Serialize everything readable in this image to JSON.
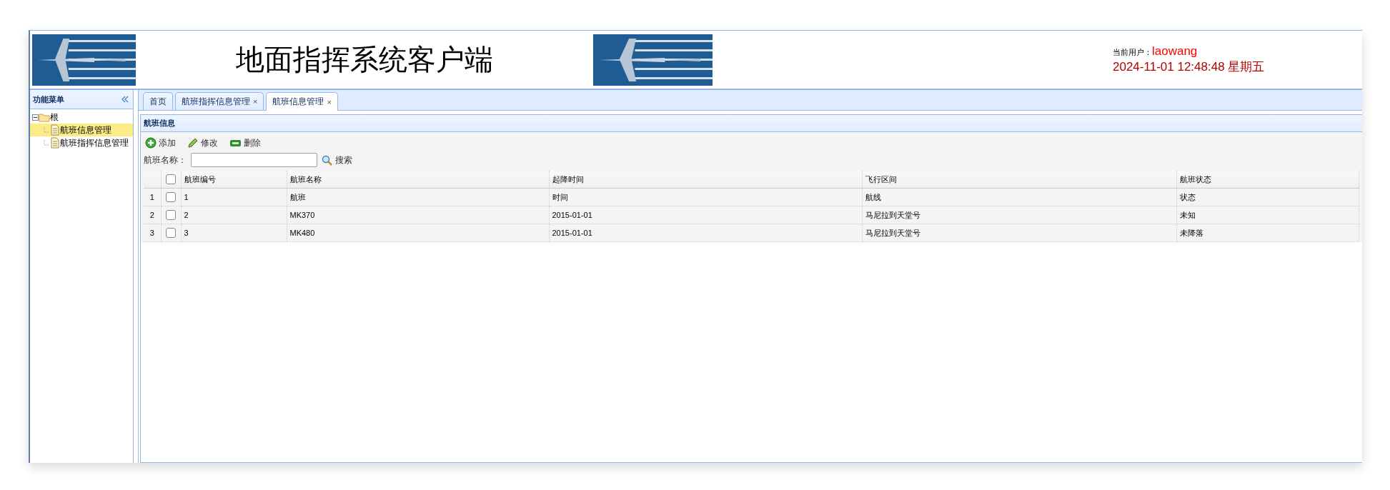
{
  "header": {
    "title": "地面指挥系统客户端",
    "user_label": "当前用户：",
    "user": "laowang",
    "datetime": "2024-11-01 12:48:48 星期五"
  },
  "sidebar": {
    "title": "功能菜单",
    "tree": [
      {
        "label": "根",
        "expanded": true,
        "children": [
          {
            "label": "航班信息管理",
            "selected": true
          },
          {
            "label": "航班指挥信息管理",
            "selected": false
          }
        ]
      }
    ]
  },
  "tabs": [
    {
      "label": "首页",
      "selected": false
    },
    {
      "label": "航班指挥信息管理",
      "close": "×",
      "selected": false
    },
    {
      "label": "航班信息管理",
      "close": "×",
      "selected": true
    }
  ],
  "panel": {
    "title": "航班信息",
    "toolbar": [
      {
        "label": "添加",
        "kind": "add"
      },
      {
        "label": "修改",
        "kind": "edit"
      },
      {
        "label": "删除",
        "kind": "remove"
      }
    ],
    "search": {
      "label": "航班名称：",
      "button": "搜索"
    }
  },
  "table": {
    "columns": [
      "航班编号",
      "航班名称",
      "起降时间",
      "飞行区间",
      "航班状态"
    ],
    "all_checked": false,
    "rows": [
      {
        "number": "1",
        "checked": false,
        "cells": [
          "1",
          "航班",
          "时间",
          "航线",
          "状态"
        ]
      },
      {
        "number": "2",
        "checked": false,
        "cells": [
          "2",
          "MK370",
          "2015-01-01",
          "马尼拉到天堂号",
          "未知"
        ]
      },
      {
        "number": "3",
        "checked": false,
        "cells": [
          "3",
          "MK480",
          "2015-01-01",
          "马尼拉到天堂号",
          "未降落"
        ]
      }
    ]
  }
}
